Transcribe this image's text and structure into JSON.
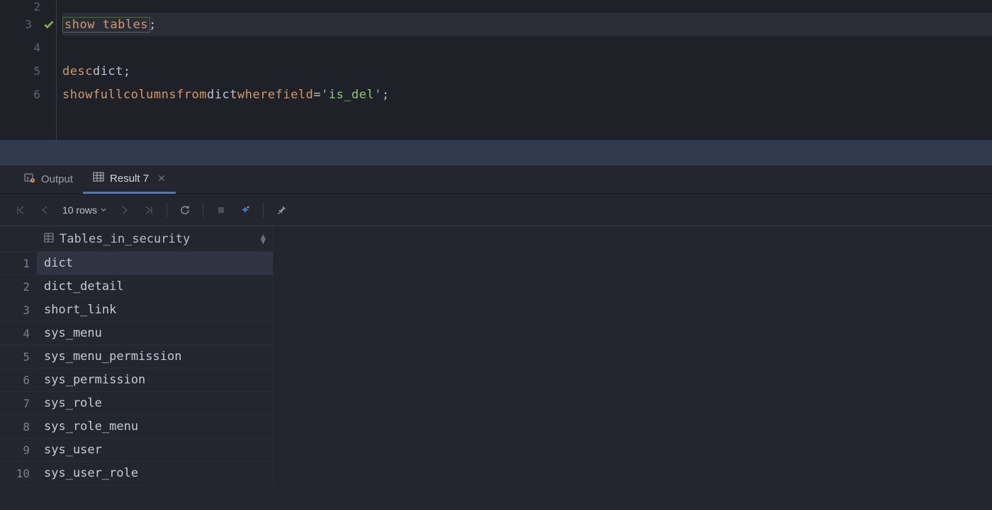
{
  "editor": {
    "lines": [
      {
        "num": "2",
        "tokens": []
      },
      {
        "num": "3",
        "active": true,
        "check": true,
        "tokens": [
          {
            "t": "kw",
            "v": "show",
            "boxed": true
          },
          {
            "t": "sp"
          },
          {
            "t": "kw",
            "v": "tables",
            "boxed": true
          },
          {
            "t": "punct",
            "v": ";"
          }
        ]
      },
      {
        "num": "4",
        "tokens": []
      },
      {
        "num": "5",
        "tokens": [
          {
            "t": "kw",
            "v": "desc"
          },
          {
            "t": "sp"
          },
          {
            "t": "id",
            "v": "dict"
          },
          {
            "t": "punct",
            "v": ";"
          }
        ]
      },
      {
        "num": "6",
        "tokens": [
          {
            "t": "kw",
            "v": "show"
          },
          {
            "t": "sp"
          },
          {
            "t": "kw",
            "v": "full"
          },
          {
            "t": "sp"
          },
          {
            "t": "kw",
            "v": "columns"
          },
          {
            "t": "sp"
          },
          {
            "t": "kw",
            "v": "from"
          },
          {
            "t": "sp"
          },
          {
            "t": "id",
            "v": "dict"
          },
          {
            "t": "sp"
          },
          {
            "t": "kw",
            "v": "where"
          },
          {
            "t": "sp"
          },
          {
            "t": "kw",
            "v": "field"
          },
          {
            "t": "sp"
          },
          {
            "t": "op",
            "v": "="
          },
          {
            "t": "sp"
          },
          {
            "t": "str",
            "v": "'is_del'"
          },
          {
            "t": "punct",
            "v": ";"
          }
        ]
      }
    ]
  },
  "tabs": {
    "output_label": "Output",
    "result_label": "Result 7"
  },
  "toolbar": {
    "rows_label": "10 rows"
  },
  "results": {
    "column_header": "Tables_in_security",
    "rows": [
      "dict",
      "dict_detail",
      "short_link",
      "sys_menu",
      "sys_menu_permission",
      "sys_permission",
      "sys_role",
      "sys_role_menu",
      "sys_user",
      "sys_user_role"
    ],
    "selected_index": 0
  }
}
